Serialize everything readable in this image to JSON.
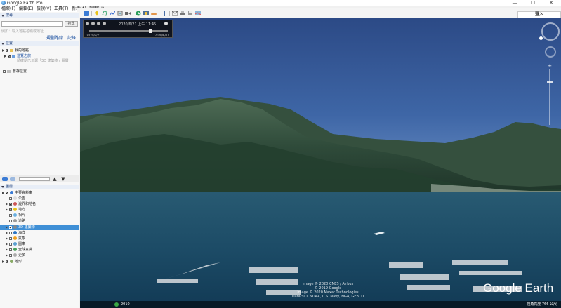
{
  "window": {
    "title": "Google Earth Pro",
    "controls": {
      "minimize": "—",
      "maximize": "☐",
      "close": "✕"
    }
  },
  "menu": [
    "檔案(F)",
    "編輯(E)",
    "檢視(V)",
    "工具(T)",
    "新增(A)",
    "說明(H)"
  ],
  "toolbar": {
    "login_label": "登入",
    "icons": [
      "sidebar-toggle-icon",
      "placemark-icon",
      "polygon-icon",
      "path-icon",
      "image-overlay-icon",
      "record-tour-icon",
      "historical-imagery-icon",
      "sunlight-icon",
      "planets-icon",
      "ruler-icon",
      "email-icon",
      "print-icon",
      "save-image-icon",
      "maps-icon"
    ]
  },
  "search": {
    "header": "搜尋",
    "placeholder": "",
    "button": "搜尋",
    "hint": "例如：輸入地點名稱或地址",
    "links": [
      "規劃路線",
      "記錄"
    ]
  },
  "places": {
    "header": "位置",
    "items": [
      {
        "label": "我的地點",
        "checked": true
      },
      {
        "label": "遊覽之旅",
        "checked": true
      },
      {
        "label": "請確認已勾選「3D 建築物」圖層",
        "checked": false
      },
      {
        "label": "暫存位置",
        "checked": false
      }
    ]
  },
  "layers": {
    "header": "圖層",
    "items": [
      {
        "label": "主要資料庫",
        "checked": true,
        "selected": false
      },
      {
        "label": "公告",
        "checked": false,
        "selected": false
      },
      {
        "label": "邊界和地名",
        "checked": true,
        "selected": false
      },
      {
        "label": "地方",
        "checked": true,
        "selected": false
      },
      {
        "label": "相片",
        "checked": false,
        "selected": false
      },
      {
        "label": "道路",
        "checked": false,
        "selected": false
      },
      {
        "label": "3D 建築物",
        "checked": true,
        "selected": true
      },
      {
        "label": "海洋",
        "checked": false,
        "selected": false
      },
      {
        "label": "氣象",
        "checked": false,
        "selected": false
      },
      {
        "label": "圖庫",
        "checked": false,
        "selected": false
      },
      {
        "label": "全球意識",
        "checked": false,
        "selected": false
      },
      {
        "label": "更多",
        "checked": false,
        "selected": false
      },
      {
        "label": "地形",
        "checked": true,
        "selected": false
      }
    ]
  },
  "timeslider": {
    "current": "2020/6/21 上午 11:45",
    "start": "2020/6/21",
    "end": "2020/6/21",
    "position": 0.78
  },
  "view": {
    "copyright_lines": [
      "Image © 2020 CNES / Airbus",
      "© 2019 Google",
      "Image © 2020 Maxar Technologies",
      "Data SIO, NOAA, U.S. Navy, NGA, GEBCO"
    ],
    "logo": "Google Earth",
    "imagery_year": "2010",
    "altitude": "視角高度 766 公尺"
  },
  "colors": {
    "selected_row": "#3f8fd6",
    "sky_top": "#2e4d8a",
    "water": "#1b4a6a"
  }
}
